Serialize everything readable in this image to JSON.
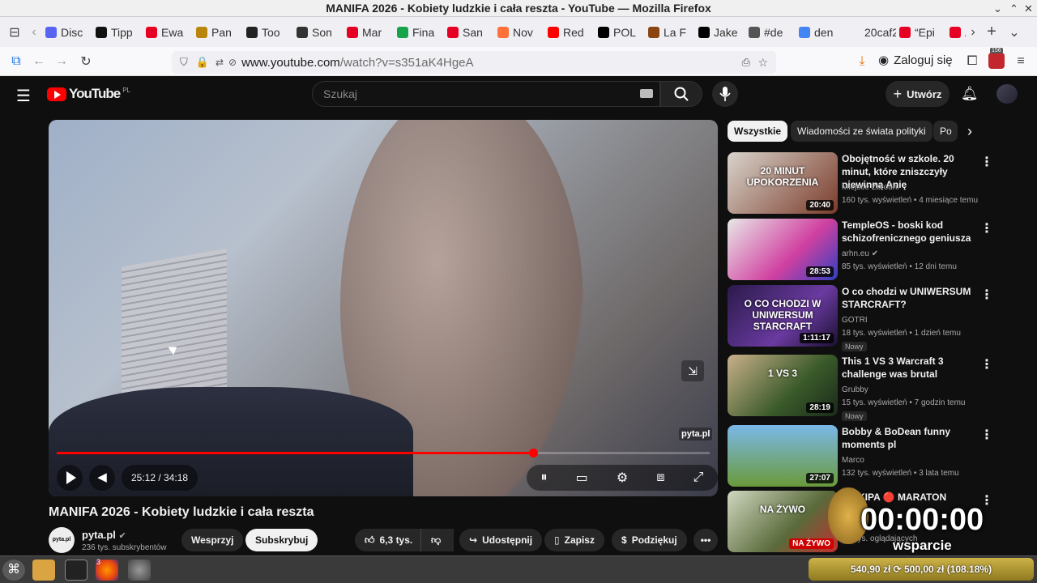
{
  "window_title": "MANIFA 2026 - Kobiety ludzkie i cała reszta - YouTube — Mozilla Firefox",
  "tabs": [
    {
      "label": "Disc",
      "color": "#5865f2"
    },
    {
      "label": "Tipp",
      "color": "#111"
    },
    {
      "label": "Ewa",
      "color": "#e60023"
    },
    {
      "label": "Pan",
      "color": "#b8860b"
    },
    {
      "label": "Too",
      "color": "#222"
    },
    {
      "label": "Son",
      "color": "#333"
    },
    {
      "label": "Mar",
      "color": "#e60023"
    },
    {
      "label": "Fina",
      "color": "#16a34a"
    },
    {
      "label": "San",
      "color": "#e60023"
    },
    {
      "label": "Nov",
      "color": "#ff7139"
    },
    {
      "label": "Red",
      "color": "#ff0000"
    },
    {
      "label": "POL",
      "color": "#000"
    },
    {
      "label": "La F",
      "color": "#8b4513"
    },
    {
      "label": "Jake",
      "color": "#000"
    },
    {
      "label": "#de",
      "color": "#555"
    },
    {
      "label": "den",
      "color": "#4285f4"
    },
    {
      "label": "20caf2",
      "color": "#f0f0f4"
    },
    {
      "label": "“Epi",
      "color": "#e60023"
    },
    {
      "label": "As",
      "color": "#e60023"
    }
  ],
  "url": {
    "host": "www.youtube.com",
    "rest": "/watch?v=s351aK4HgeA"
  },
  "login_label": "Zaloguj się",
  "ext_badge": "156",
  "youtube": {
    "logo_text": "YouTube",
    "region": "PL",
    "search_placeholder": "Szukaj",
    "create_label": "Utwórz"
  },
  "player": {
    "current_time": "25:12",
    "duration": "34:18",
    "time_display": "25:12 / 34:18",
    "progress": 0.73,
    "watermark": "pyta.pl"
  },
  "video": {
    "title": "MANIFA 2026 - Kobiety ludzkie i cała reszta",
    "channel": "pyta.pl",
    "subscribers": "236 tys. subskrybentów",
    "join_label": "Wesprzyj",
    "subscribe_label": "Subskrybuj",
    "likes": "6,3 tys.",
    "share_label": "Udostępnij",
    "save_label": "Zapisz",
    "thanks_label": "Podziękuj"
  },
  "chips": [
    "Wszystkie",
    "Wiadomości ze świata polityki",
    "Po"
  ],
  "recommendations": [
    {
      "title": "Obojętność w szkole. 20 minut, które zniszczyły niewinną Anię",
      "channel": "Miejsce Zbrodni",
      "meta": "160 tys. wyświetleń • 4 miesiące temu",
      "duration": "20:40",
      "thumb_text": "20 MINUT UPOKORZENIA",
      "verified": false,
      "new": false
    },
    {
      "title": "TempleOS - boski kod schizofrenicznego geniusza",
      "channel": "arhn.eu",
      "meta": "85 tys. wyświetleń • 12 dni temu",
      "duration": "28:53",
      "thumb_text": "",
      "verified": true,
      "new": false
    },
    {
      "title": "O co chodzi w UNIWERSUM STARCRAFT?",
      "channel": "GOTRI",
      "meta": "18 tys. wyświetleń • 1 dzień temu",
      "duration": "1:11:17",
      "thumb_text": "O CO CHODZI W UNIWERSUM STARCRAFT",
      "verified": false,
      "new": true
    },
    {
      "title": "This 1 VS 3 Warcraft 3 challenge was brutal",
      "channel": "Grubby",
      "meta": "15 tys. wyświetleń • 7 godzin temu",
      "duration": "28:19",
      "thumb_text": "1 VS 3",
      "verified": false,
      "new": true
    },
    {
      "title": "Bobby & BoDean funny moments pl",
      "channel": "Marco",
      "meta": "132 tys. wyświetleń • 3 lata temu",
      "duration": "27:07",
      "thumb_text": "",
      "verified": false,
      "new": false
    },
    {
      "title": "K EKIPA 🔴 MARATON",
      "channel": "",
      "meta": "3,8 tys. oglądających",
      "duration": "NA ŻYWO",
      "thumb_text": "NA ŻYWO",
      "verified": false,
      "new": false
    }
  ],
  "new_label": "Nowy",
  "overlay": {
    "timer": "00:00:00",
    "label": "wsparcie",
    "goal": "540,90 zł ⟳ 500,00 zł (108.18%)"
  },
  "taskbar_badge": "3"
}
